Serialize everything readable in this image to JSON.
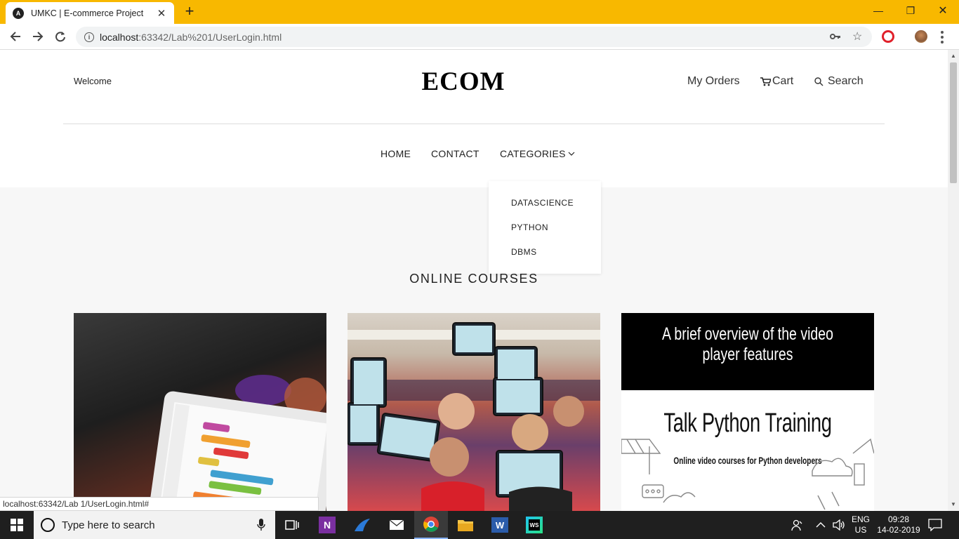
{
  "browser": {
    "tab_title": "UMKC | E-commerce Project",
    "tab_favicon_letter": "A",
    "url_host": "localhost",
    "url_rest": ":63342/Lab%201/UserLogin.html",
    "status_url": "localhost:63342/Lab 1/UserLogin.html#"
  },
  "header": {
    "welcome": "Welcome",
    "brand": "ECOM",
    "my_orders": "My Orders",
    "cart": "Cart",
    "search": "Search"
  },
  "nav": {
    "home": "HOME",
    "contact": "CONTACT",
    "categories": "CATEGORIES"
  },
  "categories_menu": [
    "DATASCIENCE",
    "PYTHON",
    "DBMS"
  ],
  "section_title": "ONLINE COURSES",
  "cards": {
    "card3_heading": "A brief overview of the video player features",
    "card3_title": "Talk Python Training",
    "card3_subtitle": "Online video courses for Python developers"
  },
  "taskbar": {
    "search_placeholder": "Type here to search",
    "lang_top": "ENG",
    "lang_bottom": "US",
    "time": "09:28",
    "date": "14-02-2019"
  },
  "colors": {
    "chrome_frame": "#f8b800",
    "page_bg": "#f7f7f7",
    "taskbar_bg": "#1f1f1f"
  }
}
